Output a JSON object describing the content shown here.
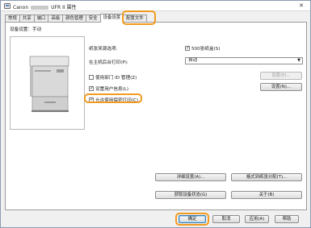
{
  "window": {
    "title_prefix": "Canon",
    "title_suffix": "UFR II 属性",
    "close_glyph": "✕"
  },
  "tabs": [
    {
      "label": "常规"
    },
    {
      "label": "共享"
    },
    {
      "label": "端口"
    },
    {
      "label": "高级"
    },
    {
      "label": "颜色管理"
    },
    {
      "label": "安全"
    },
    {
      "label": "设备设置"
    },
    {
      "label": "配置文件"
    }
  ],
  "active_tab": "设备设置",
  "device_settings": {
    "mode_label": "设备设置：手动",
    "paper_source_label": "纸张来源选项:",
    "paper_source_value": "500张纸盒(S)",
    "background_print_label": "在主机后台打印(P):",
    "background_print_value": "自动",
    "dept_id_label": "使用部门 ID 管理(Z)",
    "dept_id_settings_button": "设置(E)...",
    "user_info_label": "设置用户信息(L)",
    "user_info_settings_button": "设置(N)...",
    "secure_print_label": "允许使用保密打印(C)",
    "detailed_settings_button": "详细设置(A)...",
    "format_paper_size_button": "格式到纸张分配(T)...",
    "get_device_status_button": "获取设备状态(G)",
    "about_button": "关于(B)"
  },
  "checkboxes": {
    "paper_source": true,
    "dept_id": false,
    "user_info": true,
    "secure_print": true
  },
  "footer": {
    "ok_button": "确定",
    "cancel_button": "取消",
    "apply_button": "应用(A)",
    "help_button": "帮助"
  },
  "colors": {
    "highlight": "#f29a1f",
    "window_border": "#8a9bb0"
  }
}
